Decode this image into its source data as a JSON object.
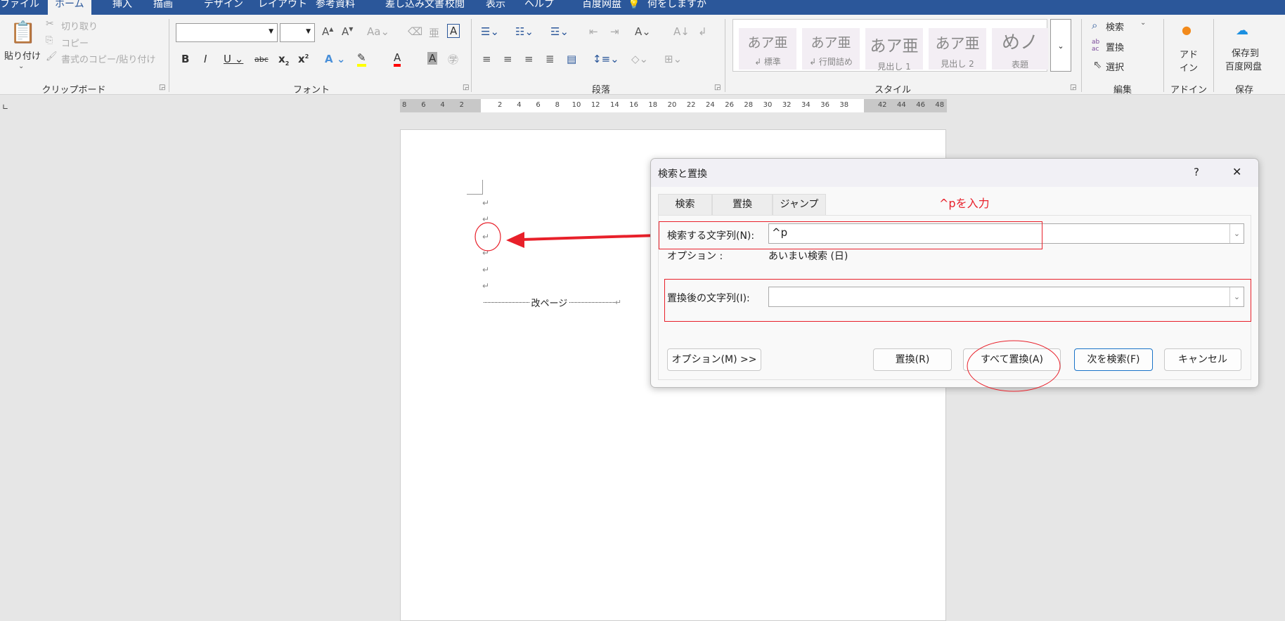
{
  "ribbon_tabs": [
    "ファイル",
    "ホーム",
    "挿入",
    "描画",
    "デザイン",
    "レイアウト",
    "参考資料",
    "差し込み文書",
    "校閲",
    "表示",
    "ヘルプ",
    "百度网盘"
  ],
  "tell_me": "何をしますか",
  "clipboard": {
    "paste": "貼り付け",
    "cut": "切り取り",
    "copy": "コピー",
    "format_painter": "書式のコピー/貼り付け",
    "label": "クリップボード"
  },
  "font": {
    "label": "フォント",
    "name_value": "",
    "size_value": ""
  },
  "paragraph": {
    "label": "段落"
  },
  "styles": {
    "label": "スタイル",
    "items": [
      {
        "preview": "あア亜",
        "name": "↲ 標準"
      },
      {
        "preview": "あア亜",
        "name": "↲ 行間詰め"
      },
      {
        "preview": "あア亜",
        "name": "見出し 1"
      },
      {
        "preview": "あア亜",
        "name": "見出し 2"
      },
      {
        "preview": "めノ",
        "name": "表題"
      }
    ]
  },
  "editing": {
    "label": "編集",
    "find": "検索",
    "replace": "置換",
    "select": "選択"
  },
  "addins": {
    "label": "アドイン",
    "button": "アド\nイン"
  },
  "save": {
    "label": "保存",
    "button1": "保存到",
    "button2": "百度网盘"
  },
  "ruler": {
    "left": [
      "8",
      "6",
      "4",
      "2"
    ],
    "right": [
      "2",
      "4",
      "6",
      "8",
      "10",
      "12",
      "14",
      "16",
      "18",
      "20",
      "22",
      "24",
      "26",
      "28",
      "30",
      "32",
      "34",
      "36",
      "38"
    ],
    "margin": [
      "42",
      "44",
      "46",
      "48"
    ]
  },
  "document": {
    "page_break": "改ページ",
    "para_mark": "↵"
  },
  "dialog": {
    "title": "検索と置換",
    "help": "?",
    "close": "✕",
    "tabs": [
      "検索",
      "置換",
      "ジャンプ"
    ],
    "find_label": "検索する文字列(N):",
    "find_value": "^p",
    "options_label": "オプション :",
    "options_value": "あいまい検索 (日)",
    "replace_label": "置換後の文字列(I):",
    "replace_value": "",
    "buttons": {
      "more": "オプション(M) >>",
      "replace": "置換(R)",
      "replace_all": "すべて置換(A)",
      "find_next": "次を検索(F)",
      "cancel": "キャンセル"
    }
  },
  "annotation": {
    "text": "^pを入力",
    "color": "#e8202a"
  },
  "colors": {
    "tabbar": "#2b579a",
    "ribbon": "#f3f3f3",
    "highlight": "#ffff00",
    "font_color": "#ff0000"
  }
}
